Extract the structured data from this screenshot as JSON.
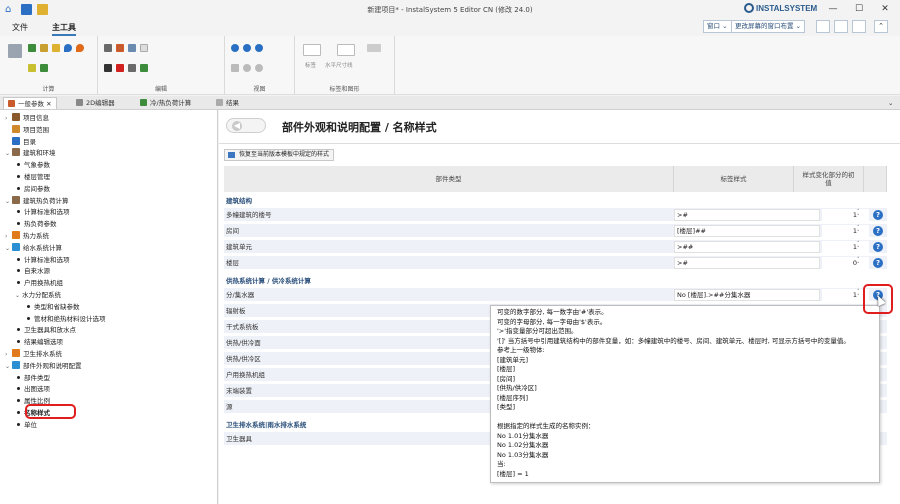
{
  "window": {
    "title": "新建项目* - InstalSystem 5 Editor CN (修改 24.0)",
    "logo": "INSTALSYSTEM"
  },
  "menu": {
    "file": "文件",
    "main_tools": "主工具"
  },
  "window_controls": {
    "window_menu": "窗口",
    "layout_menu": "更改屏幕的窗口布置"
  },
  "ribbon": {
    "groups": [
      "计算",
      "编辑",
      "视图",
      "标签和图形"
    ],
    "label_tool": "标签",
    "dim_tool": "水平尺寸线"
  },
  "tabs": [
    {
      "label": "一般参数",
      "active": true
    },
    {
      "label": "2D编辑器"
    },
    {
      "label": "冷/热负荷计算"
    },
    {
      "label": "结果"
    }
  ],
  "tree": [
    {
      "label": "项目信息",
      "level": 0,
      "arrow": "›",
      "icon": "#8a5a2b"
    },
    {
      "label": "项目范围",
      "level": 0,
      "icon": "#d08a2b"
    },
    {
      "label": "目录",
      "level": 0,
      "icon": "#2b6fc4"
    },
    {
      "label": "建筑和环境",
      "level": 0,
      "arrow": "⌄",
      "icon": "#8a6a4b"
    },
    {
      "label": "气象参数",
      "level": 1,
      "bullet": true
    },
    {
      "label": "楼层管理",
      "level": 1,
      "bullet": true
    },
    {
      "label": "房间参数",
      "level": 1,
      "bullet": true
    },
    {
      "label": "建筑热负荷计算",
      "level": 0,
      "arrow": "⌄",
      "icon": "#8a6a4b"
    },
    {
      "label": "计算标准和选项",
      "level": 1,
      "bullet": true
    },
    {
      "label": "热负荷参数",
      "level": 1,
      "bullet": true
    },
    {
      "label": "热力系统",
      "level": 0,
      "arrow": "›",
      "icon": "#e07a1a"
    },
    {
      "label": "给水系统计算",
      "level": 0,
      "arrow": "⌄",
      "icon": "#2b8fd4"
    },
    {
      "label": "计算标准和选项",
      "level": 1,
      "bullet": true
    },
    {
      "label": "自来水源",
      "level": 1,
      "bullet": true
    },
    {
      "label": "户用换热机组",
      "level": 1,
      "bullet": true
    },
    {
      "label": "水力分配系统",
      "level": 1,
      "arrow": "⌄"
    },
    {
      "label": "类型和省缺参数",
      "level": 2,
      "bullet": true
    },
    {
      "label": "管材和绝热材料设计选项",
      "level": 2,
      "bullet": true
    },
    {
      "label": "卫生器具和放水点",
      "level": 1,
      "bullet": true
    },
    {
      "label": "结果编辑选项",
      "level": 1,
      "bullet": true
    },
    {
      "label": "卫生排水系统",
      "level": 0,
      "arrow": "›",
      "icon": "#e07a1a"
    },
    {
      "label": "部件外观和说明配置",
      "level": 0,
      "arrow": "⌄",
      "icon": "#2b8fd4"
    },
    {
      "label": "部件类型",
      "level": 1,
      "bullet": true
    },
    {
      "label": "出图选项",
      "level": 1,
      "bullet": true
    },
    {
      "label": "属性比例",
      "level": 1,
      "bullet": true
    },
    {
      "label": "名称样式",
      "level": 1,
      "bullet": true,
      "selected": true
    },
    {
      "label": "单位",
      "level": 1,
      "bullet": true
    }
  ],
  "main": {
    "page_title": "部件外观和说明配置 / 名称样式",
    "back_label": "◀",
    "restore_button": "恢复至当前版本模板中规定的样式",
    "columns": [
      "部件类型",
      "标签样式",
      "样式变化部分的初值"
    ],
    "sections": [
      {
        "title": "建筑结构",
        "rows": [
          {
            "label": "多幢建筑的楼号",
            "style": ">#",
            "initial": "1"
          },
          {
            "label": "房间",
            "style": "[楼层]##",
            "initial": "1"
          },
          {
            "label": "建筑单元",
            "style": ">##",
            "initial": "1"
          },
          {
            "label": "楼层",
            "style": ">#",
            "initial": "0"
          }
        ]
      },
      {
        "title": "供热系统计算 / 供冷系统计算",
        "rows": [
          {
            "label": "分/集水器",
            "style": "No [楼层].>##分集水器",
            "initial": "1"
          },
          {
            "label": "辐射板"
          },
          {
            "label": "干式系统板"
          },
          {
            "label": "供热/供冷面"
          },
          {
            "label": "供热/供冷区"
          },
          {
            "label": "户用换热机组"
          },
          {
            "label": "末端装置"
          },
          {
            "label": "源"
          }
        ]
      },
      {
        "title": "卫生排水系统|雨水排水系统",
        "rows": [
          {
            "label": "卫生器具"
          }
        ]
      }
    ]
  },
  "tooltip": {
    "lines": [
      "可变的数字部分, 每一数字由'#'表示。",
      "可变的字母部分, 每一字母由'$'表示。",
      "'>'指变量部分可超出范围。",
      "'[]' 当方括号中引用建筑结构中的部件变量，如：多幢建筑中的楼号、房间、建筑单元、楼层时, 可显示方括号中的变量值。",
      "参考上一级物体:",
      "[建筑单元]",
      "[楼层]",
      "[房间]",
      "[供热/供冷区]",
      "[楼层序列]",
      "[类型]",
      "",
      "根据指定的样式生成的名称实例：",
      "No 1.01分集水器",
      "No 1.02分集水器",
      "No 1.03分集水器",
      "当:",
      "[楼层] = 1"
    ]
  }
}
